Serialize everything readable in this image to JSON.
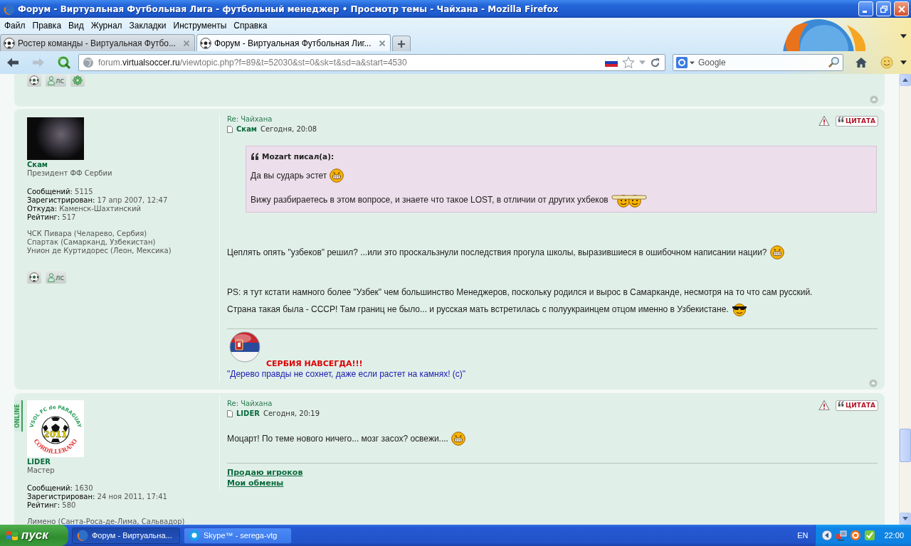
{
  "window": {
    "title": "Форум - Виртуальная Футбольная Лига - футбольный менеджер • Просмотр темы - Чайхана - Mozilla Firefox"
  },
  "menu": [
    "Файл",
    "Правка",
    "Вид",
    "Журнал",
    "Закладки",
    "Инструменты",
    "Справка"
  ],
  "tabs": [
    {
      "label": "Ростер команды - Виртуальная Футбо...",
      "selected": false
    },
    {
      "label": "Форум - Виртуальная Футбольная Лиг...",
      "selected": true
    }
  ],
  "navigation": {
    "back": {
      "disabled": false
    },
    "forward": {
      "disabled": true
    },
    "url": {
      "host_prefix": "forum.",
      "domain": "virtualsoccer.ru",
      "path": "/viewtopic.php?f=89&t=52030&st=0&sk=t&sd=a&start=4530"
    }
  },
  "search": {
    "placeholder": "Google"
  },
  "previous_post": {
    "contact_buttons": [
      {
        "kind": "www"
      },
      {
        "kind": "pm",
        "label": "лс"
      },
      {
        "kind": "icq"
      }
    ]
  },
  "posts": [
    {
      "online": false,
      "avatar": {
        "kind": "photo"
      },
      "profile": {
        "name": "Скам",
        "rank": "Президент ФФ Сербии",
        "stats": [
          {
            "label": "Сообщений:",
            "value": "5115"
          },
          {
            "label": "Зарегистрирован:",
            "value": "17 апр 2007, 12:47"
          },
          {
            "label": "Откуда:",
            "value": "Каменск-Шахтинский"
          },
          {
            "label": "Рейтинг:",
            "value": "517"
          }
        ],
        "teams": [
          "ЧСК Пивара (Челарево, Сербия)",
          "Спартак (Самарканд, Узбекистан)",
          "Унион де Куртидорес (Леон, Мексика)"
        ],
        "contact_buttons": [
          {
            "kind": "www"
          },
          {
            "kind": "pm",
            "label": "лс"
          }
        ]
      },
      "header": {
        "subject": "Re: Чайхана",
        "author": "Скам",
        "time": "Сегодня, 20:08",
        "quote_button": "ЦИТАТА"
      },
      "quote": {
        "author": "Mozart писал(а):",
        "paragraphs": [
          {
            "text": "Да вы сударь эстет",
            "smiley": {
              "kind": "grin"
            }
          },
          {
            "text": "Вижу разбираетесь в этом вопросе, и знаете что такое LOST, в отличии от других ухбеков",
            "smiley": {
              "kind": "pair"
            }
          }
        ]
      },
      "body": [
        {
          "lines": [
            {
              "text": "Цеплять опять \"узбеков\" решил? ...или это проскальзнули последствия прогула школы, выразившиеся в ошибочном написании нации?",
              "smiley": {
                "kind": "grin"
              }
            }
          ]
        },
        {
          "lines": [
            {
              "text": "PS: я тут кстати намного более \"Узбек\" чем большинство Менеджеров, поскольку родился и вырос в Самарканде, несмотря на то что сам русский."
            },
            {
              "text": "Страна такая была - СССР! Там границ не было... и русская мать встретилась с полуукраинцем отцом именно в Узбекистане.",
              "smiley": {
                "kind": "cool"
              }
            }
          ]
        }
      ],
      "signature": {
        "kind": "banner",
        "banner": "СЕРБИЯ НАВСЕГДА!!!",
        "motto": "\"Дерево правды не сохнет, даже если растет на камнях! (с)\""
      }
    },
    {
      "online": true,
      "online_label": "ONLINE",
      "avatar": {
        "kind": "logo",
        "top_text": "VSOL FC de PARAGUAY",
        "year": "2011",
        "bottom_text": "CORDILLERANO"
      },
      "profile": {
        "name": "LIDER",
        "rank": "Мастер",
        "stats": [
          {
            "label": "Сообщений:",
            "value": "1630"
          },
          {
            "label": "Зарегистрирован:",
            "value": "24 ноя 2011, 17:41"
          },
          {
            "label": "Рейтинг:",
            "value": "580"
          }
        ],
        "teams": [
          "Лимено (Санта-Роса-де-Лима, Сальвадор)"
        ]
      },
      "header": {
        "subject": "Re: Чайхана",
        "author": "LIDER",
        "time": "Сегодня, 20:19",
        "quote_button": "ЦИТАТА"
      },
      "body": [
        {
          "lines": [
            {
              "text": "Моцарт! По теме нового ничего... мозг засох? освежи....",
              "smiley": {
                "kind": "grin"
              }
            }
          ]
        }
      ],
      "signature": {
        "kind": "links",
        "links": [
          "Продаю игроков",
          "Мои обмены"
        ]
      }
    }
  ],
  "taskbar": {
    "start": "пуск",
    "items": [
      {
        "kind": "firefox",
        "label": "Форум - Виртуальна...",
        "selected": true
      },
      {
        "kind": "skype",
        "label": "Skype™ - serega-vtg",
        "selected": false
      }
    ],
    "language": "EN",
    "clock": "22:00"
  }
}
